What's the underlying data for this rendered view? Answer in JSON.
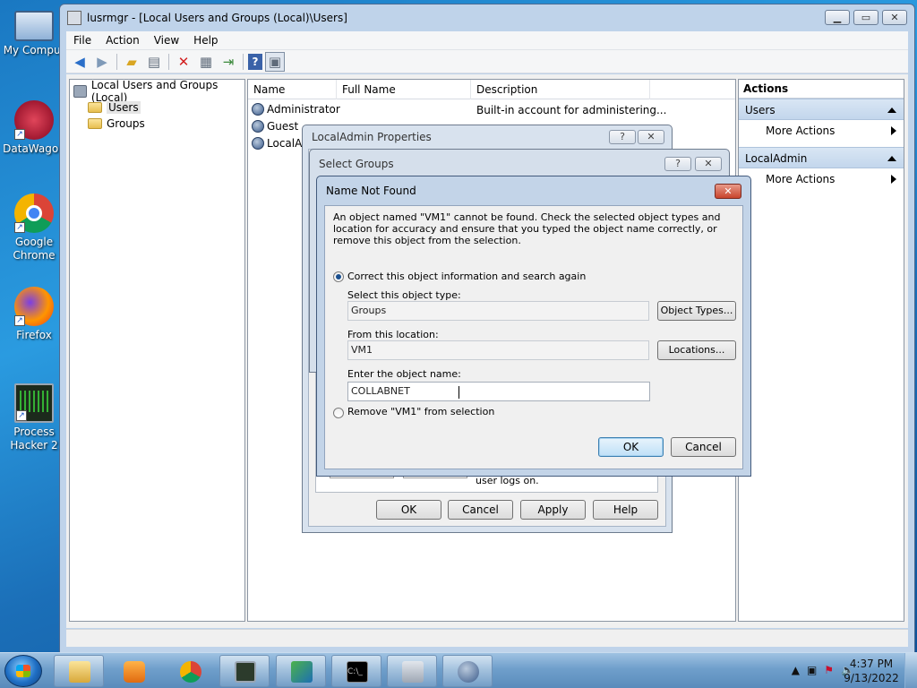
{
  "desktop": {
    "icons": [
      {
        "label": "My Comput",
        "icon": "computer-icon"
      },
      {
        "label": "DataWagon",
        "icon": "datawagon-icon"
      },
      {
        "label": "Google Chrome",
        "icon": "chrome-icon"
      },
      {
        "label": "Firefox",
        "icon": "firefox-icon"
      },
      {
        "label": "Process Hacker 2",
        "icon": "process-hacker-icon"
      }
    ]
  },
  "window": {
    "title": "lusrmgr - [Local Users and Groups (Local)\\Users]",
    "menu": [
      "File",
      "Action",
      "View",
      "Help"
    ],
    "tree": {
      "root": "Local Users and Groups (Local)",
      "items": [
        "Users",
        "Groups"
      ]
    },
    "list": {
      "columns": [
        "Name",
        "Full Name",
        "Description"
      ],
      "rows": [
        {
          "name": "Administrator",
          "full_name": "",
          "description": "Built-in account for administering..."
        },
        {
          "name": "Guest",
          "full_name": "",
          "description": ""
        },
        {
          "name": "LocalAd",
          "full_name": "",
          "description": ""
        }
      ]
    },
    "actions": {
      "header": "Actions",
      "sections": [
        {
          "title": "Users",
          "items": [
            "More Actions"
          ]
        },
        {
          "title": "LocalAdmin",
          "items": [
            "More Actions"
          ]
        }
      ]
    }
  },
  "props_dialog": {
    "title": "LocalAdmin Properties",
    "help_btn": "?",
    "close_btn": "✕",
    "partial_text": "user logs on.",
    "buttons": {
      "ok": "OK",
      "cancel": "Cancel",
      "apply": "Apply",
      "help": "Help"
    }
  },
  "select_groups": {
    "title": "Select Groups",
    "help_btn": "?",
    "close_btn": "✕"
  },
  "name_not_found": {
    "title": "Name Not Found",
    "close_btn": "✕",
    "message": "An object named \"VM1\" cannot be found. Check the selected object types and location for accuracy and ensure that you typed the object name correctly, or remove this object from the selection.",
    "option_correct": "Correct this object information and search again",
    "object_type_label": "Select this object type:",
    "object_type_value": "Groups",
    "object_types_btn": "Object Types...",
    "location_label": "From this location:",
    "location_value": "VM1",
    "locations_btn": "Locations...",
    "name_label": "Enter the object name:",
    "name_value": "COLLABNET",
    "option_remove": "Remove \"VM1\" from selection",
    "selected_option": "correct",
    "ok": "OK",
    "cancel": "Cancel"
  },
  "taskbar": {
    "apps": [
      "explorer-icon",
      "media-player-icon",
      "chrome-icon",
      "task-manager-icon",
      "network-icon",
      "cmd-icon",
      "server-manager-icon",
      "users-icon"
    ],
    "time": "4:37 PM",
    "date": "9/13/2022"
  }
}
